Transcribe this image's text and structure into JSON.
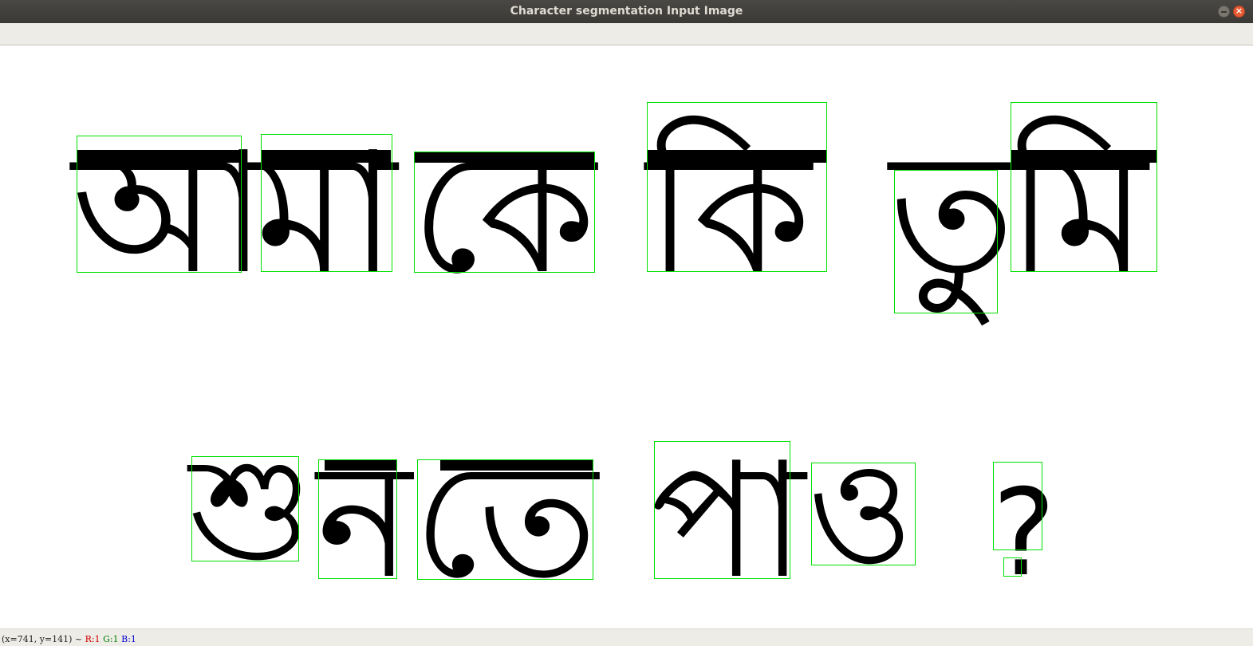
{
  "window": {
    "title": "Character segmentation Input Image",
    "minimize_label": "",
    "close_label": "×"
  },
  "image": {
    "line1": {
      "glyphs": [
        {
          "char": "আ"
        },
        {
          "char": "মা"
        },
        {
          "char": "কে"
        },
        {
          "char": "কি"
        },
        {
          "char": "তু"
        },
        {
          "char": "মি"
        }
      ]
    },
    "line2": {
      "glyphs": [
        {
          "char": "শু"
        },
        {
          "char": "ন"
        },
        {
          "char": "তে"
        },
        {
          "char": "পা"
        },
        {
          "char": "ও"
        },
        {
          "char": "?"
        }
      ]
    },
    "box_color": "#00e000",
    "text_color": "#000000"
  },
  "status": {
    "coords": "(x=741, y=141) ~",
    "r": "R:1",
    "g": "G:1",
    "b": "B:1"
  }
}
